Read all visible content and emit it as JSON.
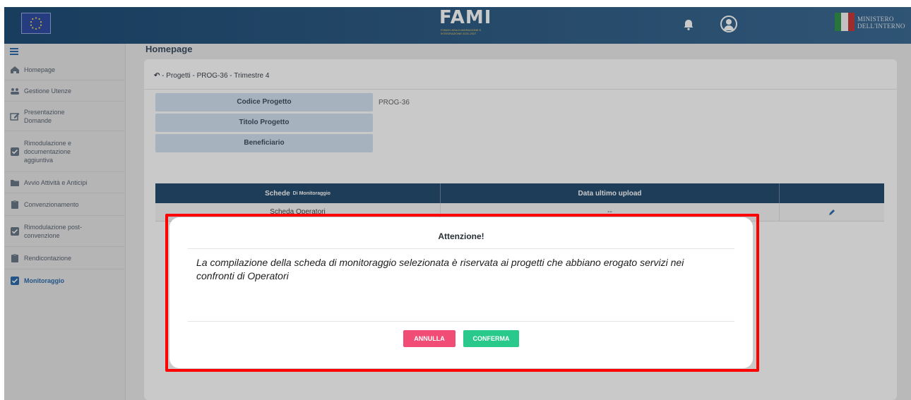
{
  "header": {
    "logo_text": "FAMI",
    "logo_subtitle": "FONDO ASILO MIGRAZIONE E INTEGRAZIONE 2021-2027",
    "ministero_line1": "MINISTERO",
    "ministero_line2": "DELL'INTERNO",
    "colors": {
      "header": "#0a3d6a",
      "it_green": "#1f8b3a",
      "it_white": "#f4f4f4",
      "it_red": "#c62828"
    }
  },
  "sidebar": {
    "items": [
      {
        "label": "Homepage",
        "icon": "home-icon"
      },
      {
        "label": "Gestione Utenze",
        "icon": "users-icon"
      },
      {
        "label": "Presentazione\nDomande",
        "icon": "edit-icon"
      },
      {
        "label": "Rimodulazione e\ndocumentazione\naggiuntiva",
        "icon": "checkbox-icon"
      },
      {
        "label": "Avvio Attività e Anticipi",
        "icon": "folder-icon"
      },
      {
        "label": "Convenzionamento",
        "icon": "clipboard-icon"
      },
      {
        "label": "Rimodulazione post-\nconvenzione",
        "icon": "checkbox-icon"
      },
      {
        "label": "Rendicontazione",
        "icon": "clipboard-icon"
      },
      {
        "label": "Monitoraggio",
        "icon": "checkbox-icon",
        "active": true
      }
    ]
  },
  "page": {
    "title": "Homepage",
    "breadcrumb": "- Progetti - PROG-36 - Trimestre 4"
  },
  "info": {
    "codice_label": "Codice Progetto",
    "codice_value": "PROG-36",
    "titolo_label": "Titolo Progetto",
    "beneficiario_label": "Beneficiario"
  },
  "table": {
    "col1": "Schede",
    "col1_small": "Di Monitoraggio",
    "col2": "Data ultimo upload",
    "row1_col1": "Scheda Operatori",
    "row1_col2": "--"
  },
  "modal": {
    "title": "Attenzione!",
    "body": "La compilazione della scheda di monitoraggio selezionata è riservata ai progetti che abbiano erogato servizi nei confronti di Operatori",
    "cancel_label": "ANNULLA",
    "confirm_label": "CONFERMA"
  }
}
